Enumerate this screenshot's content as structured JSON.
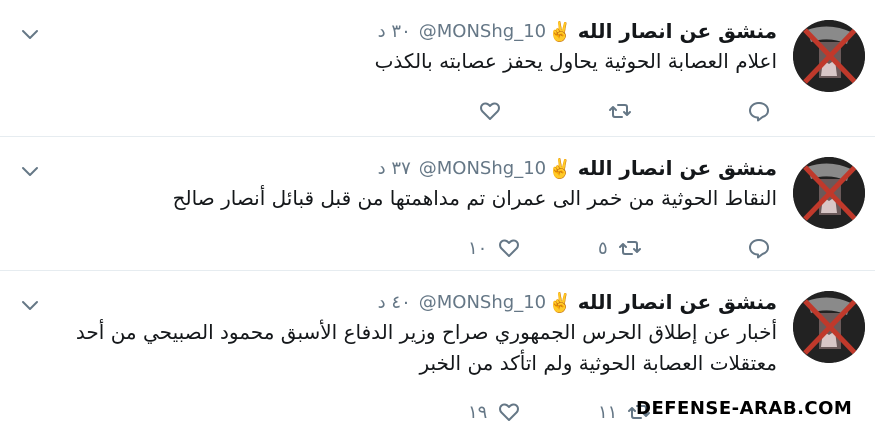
{
  "tweets": [
    {
      "name": "منشق عن انصار الله",
      "badge": "✌️",
      "handle": "@MONShg_10",
      "time": "٣٠ د",
      "text": "اعلام العصابة الحوثية يحاول يحفز عصابته بالكذب",
      "retweet_count": "",
      "like_count": ""
    },
    {
      "name": "منشق عن انصار الله",
      "badge": "✌️",
      "handle": "@MONShg_10",
      "time": "٣٧ د",
      "text": "النقاط الحوثية من خمر الى عمران تم مداهمتها من قبل قبائل أنصار صالح",
      "retweet_count": "٥",
      "like_count": "١٠"
    },
    {
      "name": "منشق عن انصار الله",
      "badge": "✌️",
      "handle": "@MONShg_10",
      "time": "٤٠ د",
      "text": "أخبار عن إطلاق الحرس الجمهوري صراح وزير الدفاع الأسبق محمود الصبيحي من أحد معتقلات العصابة الحوثية ولم اتأكد من الخبر",
      "retweet_count": "١١",
      "like_count": "١٩"
    }
  ],
  "icons": {
    "reply": "reply-icon",
    "retweet": "retweet-icon",
    "like": "heart-icon",
    "more": "chevron-down-icon"
  },
  "watermark": "DEFENSE-ARAB.COM",
  "colors": {
    "text": "#14171a",
    "muted": "#657786",
    "divider": "#e6ecf0"
  }
}
